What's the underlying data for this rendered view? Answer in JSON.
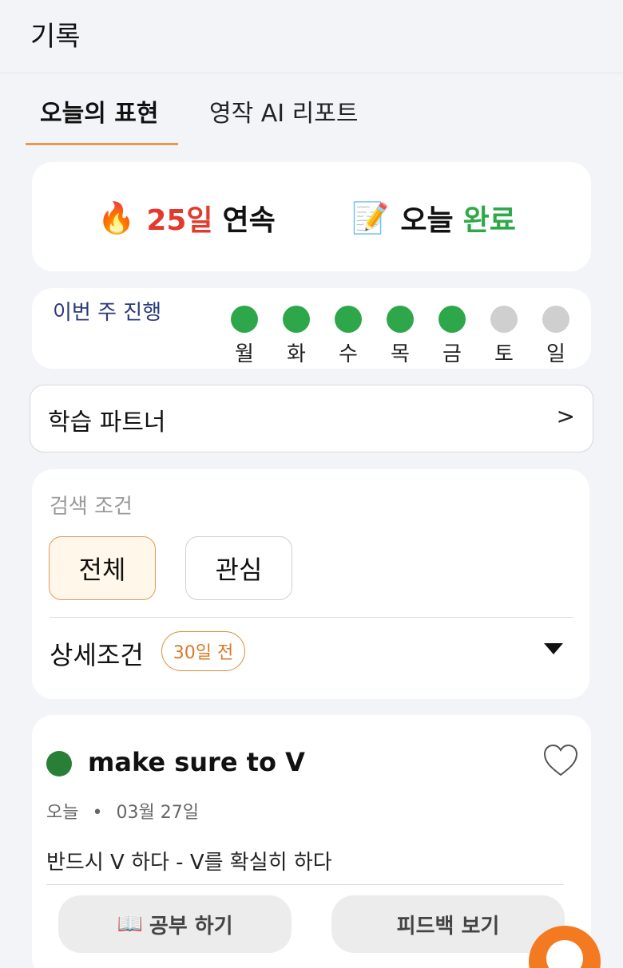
{
  "topbar": {
    "title": "기록"
  },
  "tabs": [
    {
      "label": "오늘의 표현",
      "active": true
    },
    {
      "label": "영작 AI 리포트",
      "active": false
    }
  ],
  "streak": {
    "fire_icon": "🔥",
    "days": "25일",
    "days_suffix": "연속",
    "note_icon": "📝",
    "today_label": "오늘",
    "today_status": "완료"
  },
  "week": {
    "label": "이번 주 진행",
    "days": [
      {
        "label": "월",
        "done": true
      },
      {
        "label": "화",
        "done": true
      },
      {
        "label": "수",
        "done": true
      },
      {
        "label": "목",
        "done": true
      },
      {
        "label": "금",
        "done": true
      },
      {
        "label": "토",
        "done": false
      },
      {
        "label": "일",
        "done": false
      }
    ]
  },
  "partner": {
    "label": "학습 파트너",
    "arrow": ">"
  },
  "filter": {
    "label": "검색 조건",
    "options": [
      "전체",
      "관심"
    ],
    "selected": "전체",
    "detail_label": "상세조건",
    "badge": "30일 전"
  },
  "expression": {
    "phrase": "make sure to V",
    "date_prefix": "오늘",
    "separator": "•",
    "date": "03월 27일",
    "meaning": "반드시 V 하다 - V를 확실히 하다",
    "study_icon": "📖",
    "study_label": "공부 하기",
    "feedback_label": "피드백 보기"
  },
  "colors": {
    "accent": "#e29a5a",
    "streak_red": "#e23b2e",
    "done_green": "#2ea64a",
    "fab_orange": "#f47a22"
  }
}
